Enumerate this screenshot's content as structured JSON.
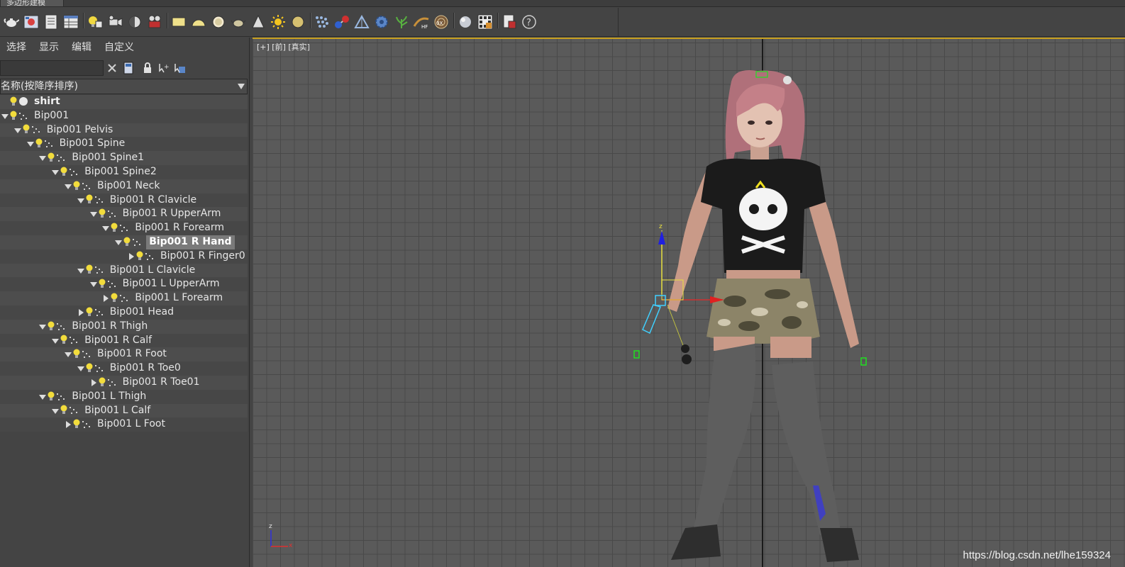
{
  "ribbon": {
    "tab_label": "多边形建模"
  },
  "toolbar": {
    "icons": [
      "teapot-icon",
      "render-frame-icon",
      "document-list-icon",
      "table-icon",
      "light-bulb-icon",
      "camera-icon",
      "sphere-half-icon",
      "film-camera-icon",
      "plane-icon",
      "hemisphere-icon",
      "disc-icon",
      "teapot-small-icon",
      "cone-icon",
      "sun-icon",
      "sphere-gold-icon",
      "dots-icon",
      "molecule-icon",
      "scale-icon",
      "gear-icon",
      "plant-icon",
      "hair-icon",
      "map-icon",
      "gray-sphere-icon",
      "grid-image-icon",
      "doc-icon",
      "help-icon"
    ]
  },
  "explorer": {
    "menu": [
      "选择",
      "显示",
      "编辑",
      "自定义"
    ],
    "search_placeholder": "",
    "sort_label": "名称(按降序排序)",
    "rows": [
      {
        "label": "shirt",
        "depth": 0,
        "toggle": "none",
        "type": "mesh",
        "bold": true
      },
      {
        "label": "Bip001",
        "depth": 0,
        "toggle": "open",
        "type": "bone"
      },
      {
        "label": "Bip001 Pelvis",
        "depth": 1,
        "toggle": "open",
        "type": "bone"
      },
      {
        "label": "Bip001 Spine",
        "depth": 2,
        "toggle": "open",
        "type": "bone"
      },
      {
        "label": "Bip001 Spine1",
        "depth": 3,
        "toggle": "open",
        "type": "bone"
      },
      {
        "label": "Bip001 Spine2",
        "depth": 4,
        "toggle": "open",
        "type": "bone"
      },
      {
        "label": "Bip001 Neck",
        "depth": 5,
        "toggle": "open",
        "type": "bone"
      },
      {
        "label": "Bip001 R Clavicle",
        "depth": 6,
        "toggle": "open",
        "type": "bone"
      },
      {
        "label": "Bip001 R UpperArm",
        "depth": 7,
        "toggle": "open",
        "type": "bone"
      },
      {
        "label": "Bip001 R Forearm",
        "depth": 8,
        "toggle": "open",
        "type": "bone"
      },
      {
        "label": "Bip001 R Hand",
        "depth": 9,
        "toggle": "open",
        "type": "bone",
        "selected": true
      },
      {
        "label": "Bip001 R Finger0",
        "depth": 10,
        "toggle": "closed",
        "type": "bone"
      },
      {
        "label": "Bip001 L Clavicle",
        "depth": 6,
        "toggle": "open",
        "type": "bone"
      },
      {
        "label": "Bip001 L UpperArm",
        "depth": 7,
        "toggle": "open",
        "type": "bone"
      },
      {
        "label": "Bip001 L Forearm",
        "depth": 8,
        "toggle": "closed",
        "type": "bone"
      },
      {
        "label": "Bip001 Head",
        "depth": 6,
        "toggle": "closed",
        "type": "bone"
      },
      {
        "label": "Bip001 R Thigh",
        "depth": 3,
        "toggle": "open",
        "type": "bone"
      },
      {
        "label": "Bip001 R Calf",
        "depth": 4,
        "toggle": "open",
        "type": "bone"
      },
      {
        "label": "Bip001 R Foot",
        "depth": 5,
        "toggle": "open",
        "type": "bone"
      },
      {
        "label": "Bip001 R Toe0",
        "depth": 6,
        "toggle": "open",
        "type": "bone"
      },
      {
        "label": "Bip001 R Toe01",
        "depth": 7,
        "toggle": "closed",
        "type": "bone"
      },
      {
        "label": "Bip001 L Thigh",
        "depth": 3,
        "toggle": "open",
        "type": "bone"
      },
      {
        "label": "Bip001 L Calf",
        "depth": 4,
        "toggle": "open",
        "type": "bone"
      },
      {
        "label": "Bip001 L Foot",
        "depth": 5,
        "toggle": "closed",
        "type": "bone"
      }
    ]
  },
  "viewport": {
    "label": "[+] [前] [真实]",
    "axis_z": "z",
    "axis_x": "x",
    "watermark": "https://blog.csdn.net/lhe159324",
    "colors": {
      "grid_bg": "#5a5a5a",
      "grid_line": "#494949",
      "active_border": "#c8a020"
    }
  }
}
